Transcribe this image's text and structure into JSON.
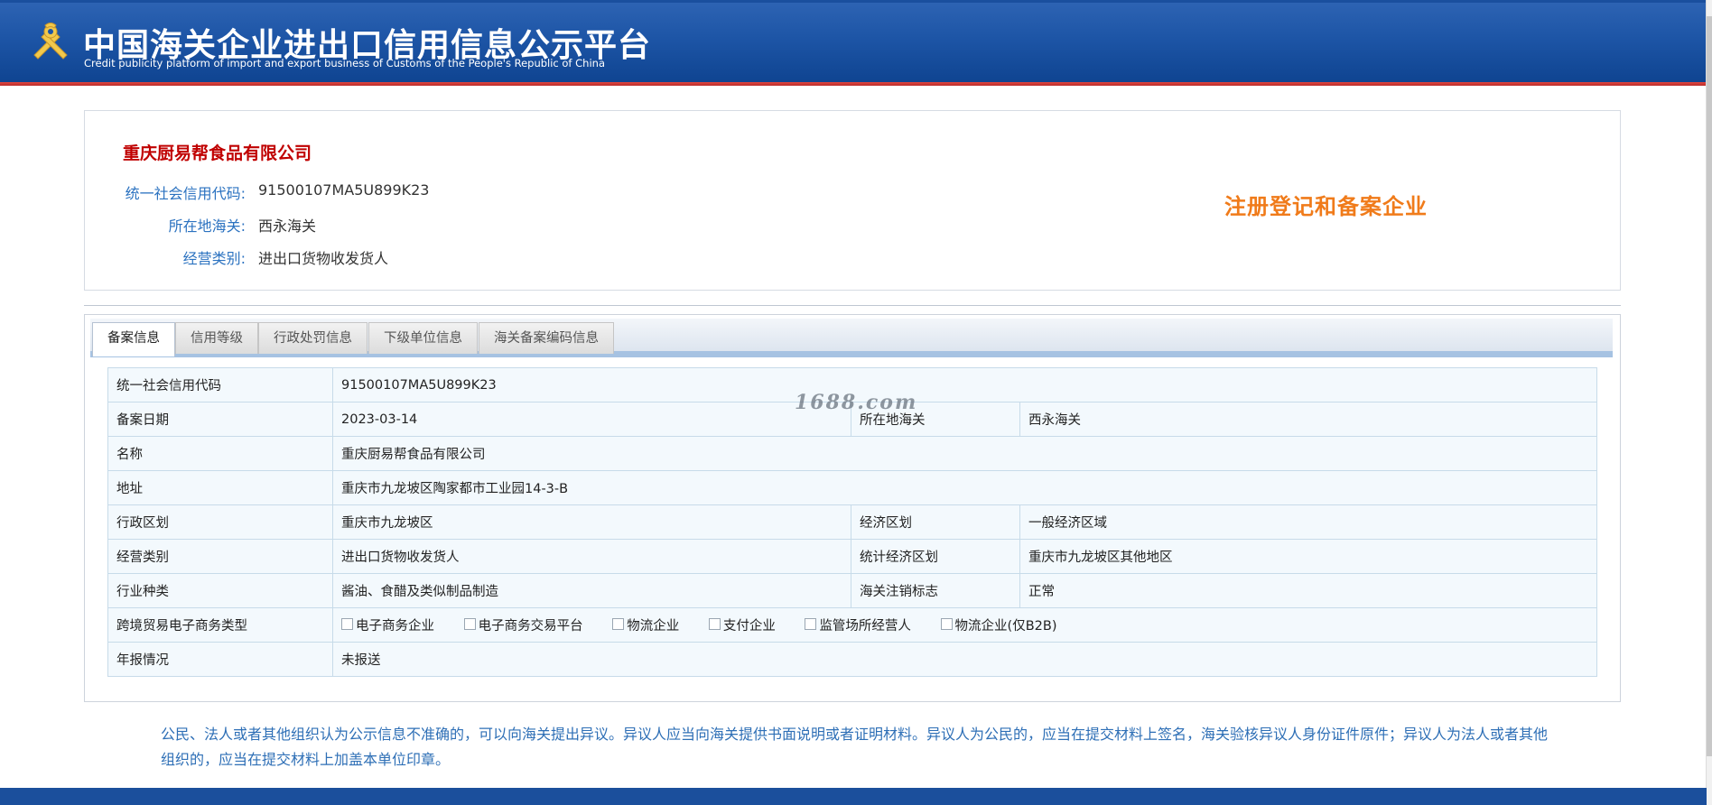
{
  "header": {
    "title_cn": "中国海关企业进出口信用信息公示平台",
    "title_en": "Credit publicity platform of import and export business of Customs of the People's Republic of China",
    "logo_icon": "customs-emblem-icon"
  },
  "company": {
    "name": "重庆厨易帮食品有限公司",
    "fields": [
      {
        "label": "统一社会信用代码:",
        "value": "91500107MA5U899K23"
      },
      {
        "label": "所在地海关:",
        "value": "西永海关"
      },
      {
        "label": "经营类别:",
        "value": "进出口货物收发货人"
      }
    ],
    "status_stamp": "注册登记和备案企业"
  },
  "tabs": [
    {
      "label": "备案信息",
      "active": true
    },
    {
      "label": "信用等级",
      "active": false
    },
    {
      "label": "行政处罚信息",
      "active": false
    },
    {
      "label": "下级单位信息",
      "active": false
    },
    {
      "label": "海关备案编码信息",
      "active": false
    }
  ],
  "record": {
    "credit_code": {
      "label": "统一社会信用代码",
      "value": "91500107MA5U899K23"
    },
    "record_date": {
      "label": "备案日期",
      "value": "2023-03-14"
    },
    "customs": {
      "label": "所在地海关",
      "value": "西永海关"
    },
    "name": {
      "label": "名称",
      "value": "重庆厨易帮食品有限公司"
    },
    "address": {
      "label": "地址",
      "value": "重庆市九龙坡区陶家都市工业园14-3-B"
    },
    "admin_region": {
      "label": "行政区划",
      "value": "重庆市九龙坡区"
    },
    "econ_region": {
      "label": "经济区划",
      "value": "一般经济区域"
    },
    "business_type": {
      "label": "经营类别",
      "value": "进出口货物收发货人"
    },
    "stat_region": {
      "label": "统计经济区划",
      "value": "重庆市九龙坡区其他地区"
    },
    "industry": {
      "label": "行业种类",
      "value": "酱油、食醋及类似制品制造"
    },
    "cancel_flag": {
      "label": "海关注销标志",
      "value": "正常"
    },
    "ecommerce": {
      "label": "跨境贸易电子商务类型",
      "options": [
        "电子商务企业",
        "电子商务交易平台",
        "物流企业",
        "支付企业",
        "监管场所经营人",
        "物流企业(仅B2B)"
      ]
    },
    "annual_report": {
      "label": "年报情况",
      "value": "未报送"
    }
  },
  "watermark": "1688.com",
  "notice": "公民、法人或者其他组织认为公示信息不准确的，可以向海关提出异议。异议人应当向海关提供书面说明或者证明材料。异议人为公民的，应当在提交材料上签名，海关验核异议人身份证件原件；异议人为法人或者其他组织的，应当在提交材料上加盖本单位印章。",
  "colors": {
    "header_blue": "#1d55a6",
    "company_red": "#c00000",
    "label_blue": "#2b72c0",
    "stamp_orange": "#f07b1a"
  }
}
